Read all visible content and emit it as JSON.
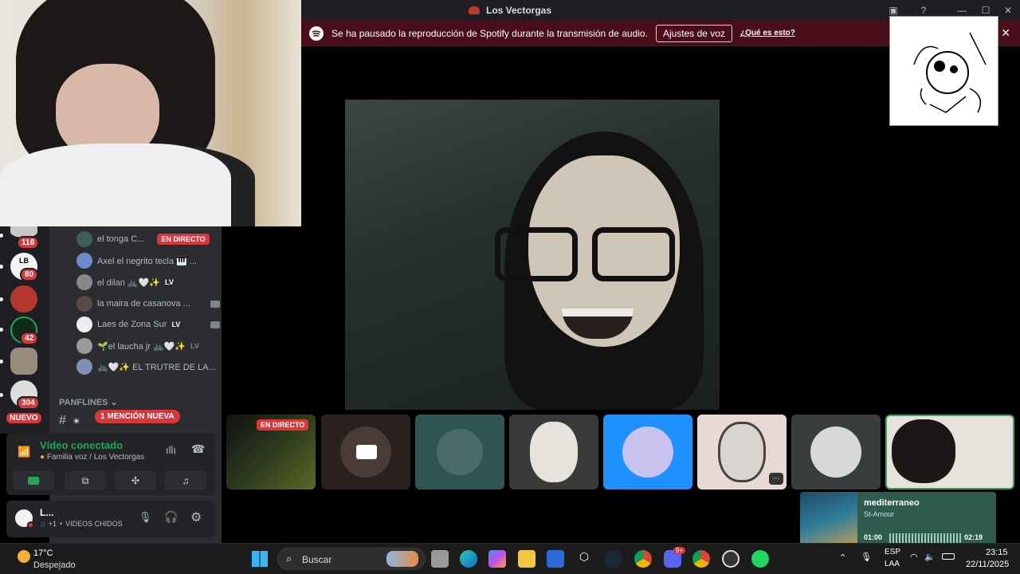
{
  "window": {
    "title": "Los Vectorgas"
  },
  "banner": {
    "message": "Se ha pausado la reproducción de Spotify durante la transmisión de audio.",
    "button_label": "Ajustes de voz",
    "link_label": "¿Qué es esto?"
  },
  "rail": {
    "badges": [
      "118",
      "80",
      "42",
      "304"
    ],
    "new_label": "NUEVO"
  },
  "voice_users": [
    {
      "name": "el tonga C...",
      "status": "EN DIRECTO"
    },
    {
      "name": "Axel el negrito tecla 🎹 ..."
    },
    {
      "name": "el dilan 🚲🤍✨",
      "tag": "LV"
    },
    {
      "name": "la maira de casanova ..."
    },
    {
      "name": "Laes de Zona Sur",
      "tag": "LV"
    },
    {
      "name": "🌱el laucha jr 🚲🤍✨",
      "tag": "LV"
    },
    {
      "name": "🚲🤍✨ EL TRUTRE DE LA..."
    }
  ],
  "category": {
    "label": "PANFLINES ⌄"
  },
  "mention_badge": "1 MENCIÓN NUEVA",
  "voice": {
    "status": "Vídeo conectado",
    "channel": "Familia voz / Los Vectorgas"
  },
  "user": {
    "name": "L...",
    "status": "VIDEOS CHIDOS",
    "extra": "+1"
  },
  "tiles": {
    "live_label": "EN DIRECTO"
  },
  "music": {
    "title": "mediterraneo",
    "artist": "St-Amour",
    "elapsed": "01:00",
    "duration": "02:19"
  },
  "taskbar": {
    "weather_temp": "17°C",
    "weather_desc": "Despejado",
    "search_placeholder": "Buscar",
    "lang_top": "ESP",
    "lang_bottom": "LAA",
    "time": "23:15",
    "date": "22/11/2025",
    "discord_badge": "9+"
  },
  "colors": {
    "discord_dark": "#1e1f22",
    "panel": "#2b2d31",
    "live_red": "#da373c",
    "connected_green": "#23a55a",
    "banner": "#4a0d1a",
    "selected_tile_border": "#3ba55d"
  }
}
